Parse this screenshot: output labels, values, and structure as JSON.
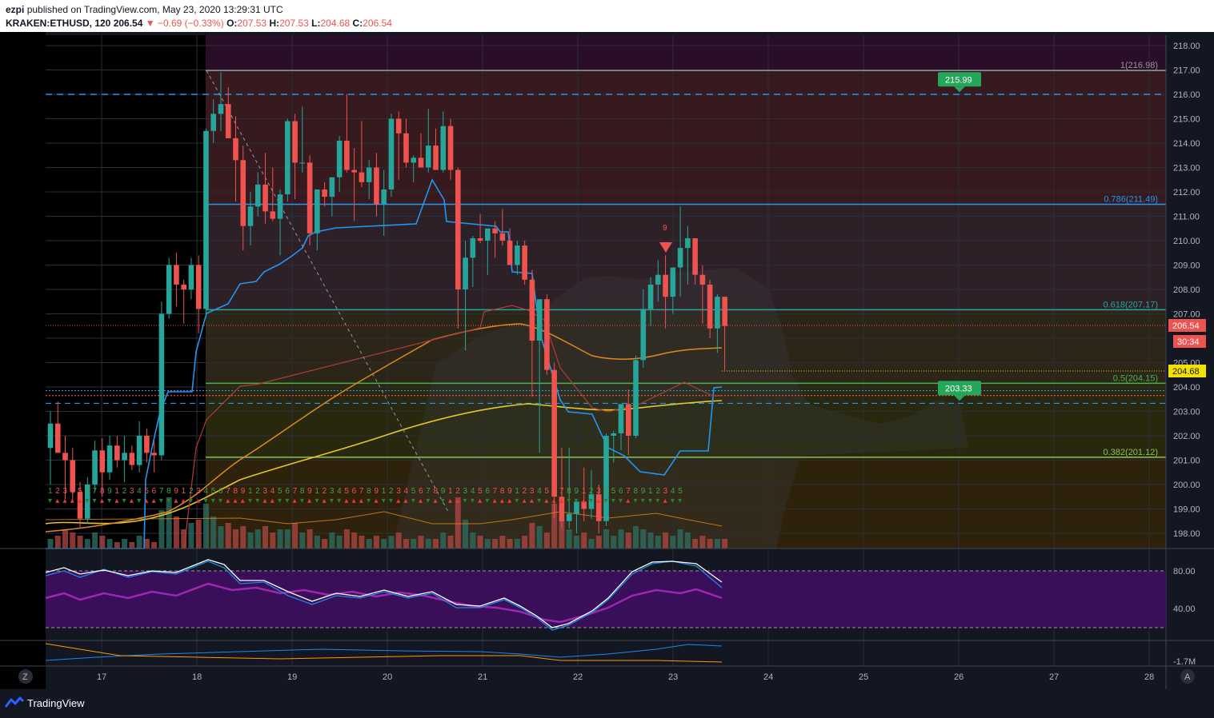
{
  "header": {
    "author": "ezpi",
    "published_text": "published on TradingView.com, May 23, 2020 13:29:31 UTC",
    "symbol": "KRAKEN:ETHUSD, 120",
    "last": "206.54",
    "change": "−0.69 (−0.33%)",
    "o_label": "O:",
    "o": "207.53",
    "h_label": "H:",
    "h": "207.53",
    "l_label": "L:",
    "l": "204.68",
    "c_label": "C:",
    "c": "206.54"
  },
  "footer": {
    "brand": "TradingView",
    "zoom_btn": "Z",
    "auto_btn": "A"
  },
  "price_badges": {
    "last": "206.54",
    "countdown": "30:34",
    "low": "204.68"
  },
  "alerts": [
    {
      "label": "215.99",
      "price": 215.99
    },
    {
      "label": "203.33",
      "price": 203.33
    }
  ],
  "fib_levels": [
    {
      "label": "1(216.98)",
      "price": 216.98,
      "color": "#9598a1"
    },
    {
      "label": "0.786(211.49)",
      "price": 211.49,
      "color": "#2196f3"
    },
    {
      "label": "0.618(207.17)",
      "price": 207.17,
      "color": "#26a69a"
    },
    {
      "label": "0.5(204.15)",
      "price": 204.15,
      "color": "#4caf50"
    },
    {
      "label": "0.382(201.12)",
      "price": 201.12,
      "color": "#8bc34a"
    }
  ],
  "horizontal_lines": [
    216.0,
    203.33,
    203.85,
    203.65
  ],
  "chart_data": {
    "type": "candlestick",
    "symbol": "KRAKEN:ETHUSD",
    "timeframe": "120",
    "y_ticks": [
      218.0,
      217.0,
      216.0,
      215.0,
      214.0,
      213.0,
      212.0,
      211.0,
      210.0,
      209.0,
      208.0,
      207.0,
      206.0,
      205.0,
      204.0,
      203.0,
      202.0,
      201.0,
      200.0,
      199.0,
      198.0
    ],
    "x_ticks": [
      "17",
      "18",
      "19",
      "20",
      "21",
      "22",
      "23",
      "24",
      "25",
      "26",
      "27",
      "28"
    ],
    "ylim": [
      197.4,
      218.3
    ],
    "candles": [
      [
        201.5,
        203.0,
        200.0,
        202.5
      ],
      [
        202.5,
        203.4,
        201.8,
        201.3
      ],
      [
        201.3,
        202.0,
        199.4,
        201.0
      ],
      [
        201.0,
        201.5,
        199.3,
        199.7
      ],
      [
        199.7,
        200.1,
        198.2,
        198.6
      ],
      [
        198.6,
        200.3,
        198.4,
        200.0
      ],
      [
        200.0,
        201.8,
        199.7,
        201.4
      ],
      [
        201.4,
        201.9,
        199.5,
        200.5
      ],
      [
        200.5,
        202.0,
        200.2,
        201.6
      ],
      [
        201.6,
        202.0,
        200.7,
        201.0
      ],
      [
        201.0,
        202.0,
        200.1,
        201.3
      ],
      [
        201.3,
        201.6,
        200.6,
        200.8
      ],
      [
        200.8,
        202.6,
        200.5,
        202.0
      ],
      [
        202.0,
        202.3,
        200.9,
        201.3
      ],
      [
        201.3,
        201.8,
        200.5,
        201.2
      ],
      [
        201.2,
        207.5,
        201.0,
        207.0
      ],
      [
        207.0,
        209.3,
        206.8,
        209.0
      ],
      [
        209.0,
        209.5,
        207.3,
        208.2
      ],
      [
        208.2,
        208.4,
        206.6,
        208.0
      ],
      [
        208.0,
        209.3,
        207.6,
        209.0
      ],
      [
        209.0,
        209.4,
        206.2,
        207.2
      ],
      [
        207.2,
        214.6,
        207.0,
        214.5
      ],
      [
        214.5,
        215.8,
        214.0,
        215.2
      ],
      [
        215.2,
        216.9,
        214.5,
        215.6
      ],
      [
        215.6,
        216.3,
        214.9,
        214.2
      ],
      [
        214.2,
        215.1,
        211.6,
        213.3
      ],
      [
        213.3,
        213.9,
        209.6,
        210.6
      ],
      [
        210.6,
        212.0,
        209.8,
        211.4
      ],
      [
        211.4,
        212.8,
        211.0,
        212.3
      ],
      [
        212.3,
        213.6,
        210.7,
        211.2
      ],
      [
        211.2,
        213.0,
        210.8,
        210.9
      ],
      [
        210.9,
        212.1,
        209.4,
        211.9
      ],
      [
        211.9,
        215.0,
        211.6,
        214.9
      ],
      [
        214.9,
        215.2,
        211.7,
        213.2
      ],
      [
        213.2,
        215.5,
        212.8,
        213.2
      ],
      [
        213.2,
        213.5,
        209.8,
        210.3
      ],
      [
        210.3,
        212.1,
        209.6,
        212.1
      ],
      [
        212.1,
        212.4,
        211.4,
        211.8
      ],
      [
        211.8,
        212.2,
        211.0,
        212.6
      ],
      [
        212.6,
        214.3,
        212.0,
        214.1
      ],
      [
        214.1,
        216.0,
        212.8,
        212.9
      ],
      [
        212.9,
        213.8,
        210.8,
        212.8
      ],
      [
        212.8,
        214.9,
        212.2,
        212.4
      ],
      [
        212.4,
        213.3,
        211.7,
        213.0
      ],
      [
        213.0,
        213.6,
        211.0,
        211.5
      ],
      [
        211.5,
        212.9,
        210.2,
        212.1
      ],
      [
        212.1,
        215.2,
        211.8,
        215.0
      ],
      [
        215.0,
        215.3,
        212.5,
        214.4
      ],
      [
        214.4,
        215.0,
        213.0,
        213.2
      ],
      [
        213.2,
        213.5,
        212.4,
        213.4
      ],
      [
        213.4,
        214.4,
        213.0,
        213.0
      ],
      [
        213.0,
        215.4,
        212.8,
        213.9
      ],
      [
        213.9,
        214.6,
        213.3,
        212.9
      ],
      [
        212.9,
        215.3,
        212.8,
        214.7
      ],
      [
        214.7,
        215.0,
        212.5,
        212.9
      ],
      [
        212.9,
        213.0,
        206.4,
        208.0
      ],
      [
        208.0,
        210.0,
        205.5,
        209.3
      ],
      [
        209.3,
        210.2,
        208.1,
        210.1
      ],
      [
        210.1,
        211.1,
        209.9,
        210.0
      ],
      [
        210.0,
        210.5,
        208.6,
        210.5
      ],
      [
        210.5,
        210.8,
        209.3,
        210.3
      ],
      [
        210.3,
        211.3,
        209.8,
        210.0
      ],
      [
        210.0,
        210.5,
        209.3,
        209.0
      ],
      [
        209.0,
        210.0,
        208.6,
        209.8
      ],
      [
        209.8,
        210.0,
        208.2,
        208.4
      ],
      [
        208.4,
        208.8,
        203.6,
        205.9
      ],
      [
        205.9,
        206.9,
        201.3,
        207.6
      ],
      [
        207.6,
        207.8,
        204.5,
        204.7
      ],
      [
        204.7,
        205.0,
        198.6,
        199.5
      ],
      [
        199.5,
        201.5,
        198.2,
        198.5
      ],
      [
        198.5,
        201.5,
        198.2,
        198.8
      ],
      [
        198.8,
        199.3,
        198.0,
        199.3
      ],
      [
        199.3,
        200.7,
        198.5,
        199.0
      ],
      [
        199.0,
        200.6,
        198.6,
        199.6
      ],
      [
        199.6,
        200.0,
        198.0,
        198.5
      ],
      [
        198.5,
        202.1,
        198.3,
        202.0
      ],
      [
        202.0,
        202.2,
        200.9,
        202.1
      ],
      [
        202.1,
        203.1,
        201.4,
        203.3
      ],
      [
        203.3,
        203.9,
        201.2,
        202.0
      ],
      [
        202.0,
        205.3,
        201.9,
        205.1
      ],
      [
        205.1,
        208.0,
        204.8,
        207.2
      ],
      [
        207.2,
        208.5,
        206.5,
        208.2
      ],
      [
        208.2,
        209.2,
        207.5,
        208.6
      ],
      [
        208.6,
        209.4,
        206.4,
        207.7
      ],
      [
        207.7,
        208.7,
        207.0,
        208.9
      ],
      [
        208.9,
        211.4,
        207.7,
        209.7
      ],
      [
        209.7,
        210.6,
        208.2,
        210.1
      ],
      [
        210.1,
        209.9,
        208.2,
        208.6
      ],
      [
        208.6,
        209.0,
        206.6,
        208.2
      ],
      [
        208.2,
        208.4,
        206.0,
        206.4
      ],
      [
        206.4,
        207.8,
        205.4,
        207.7
      ],
      [
        207.7,
        207.6,
        204.7,
        206.5
      ]
    ]
  },
  "rsi": {
    "ticks": [
      80.0,
      40.0
    ]
  },
  "volume_pane": {
    "tick": "-1.7M"
  }
}
